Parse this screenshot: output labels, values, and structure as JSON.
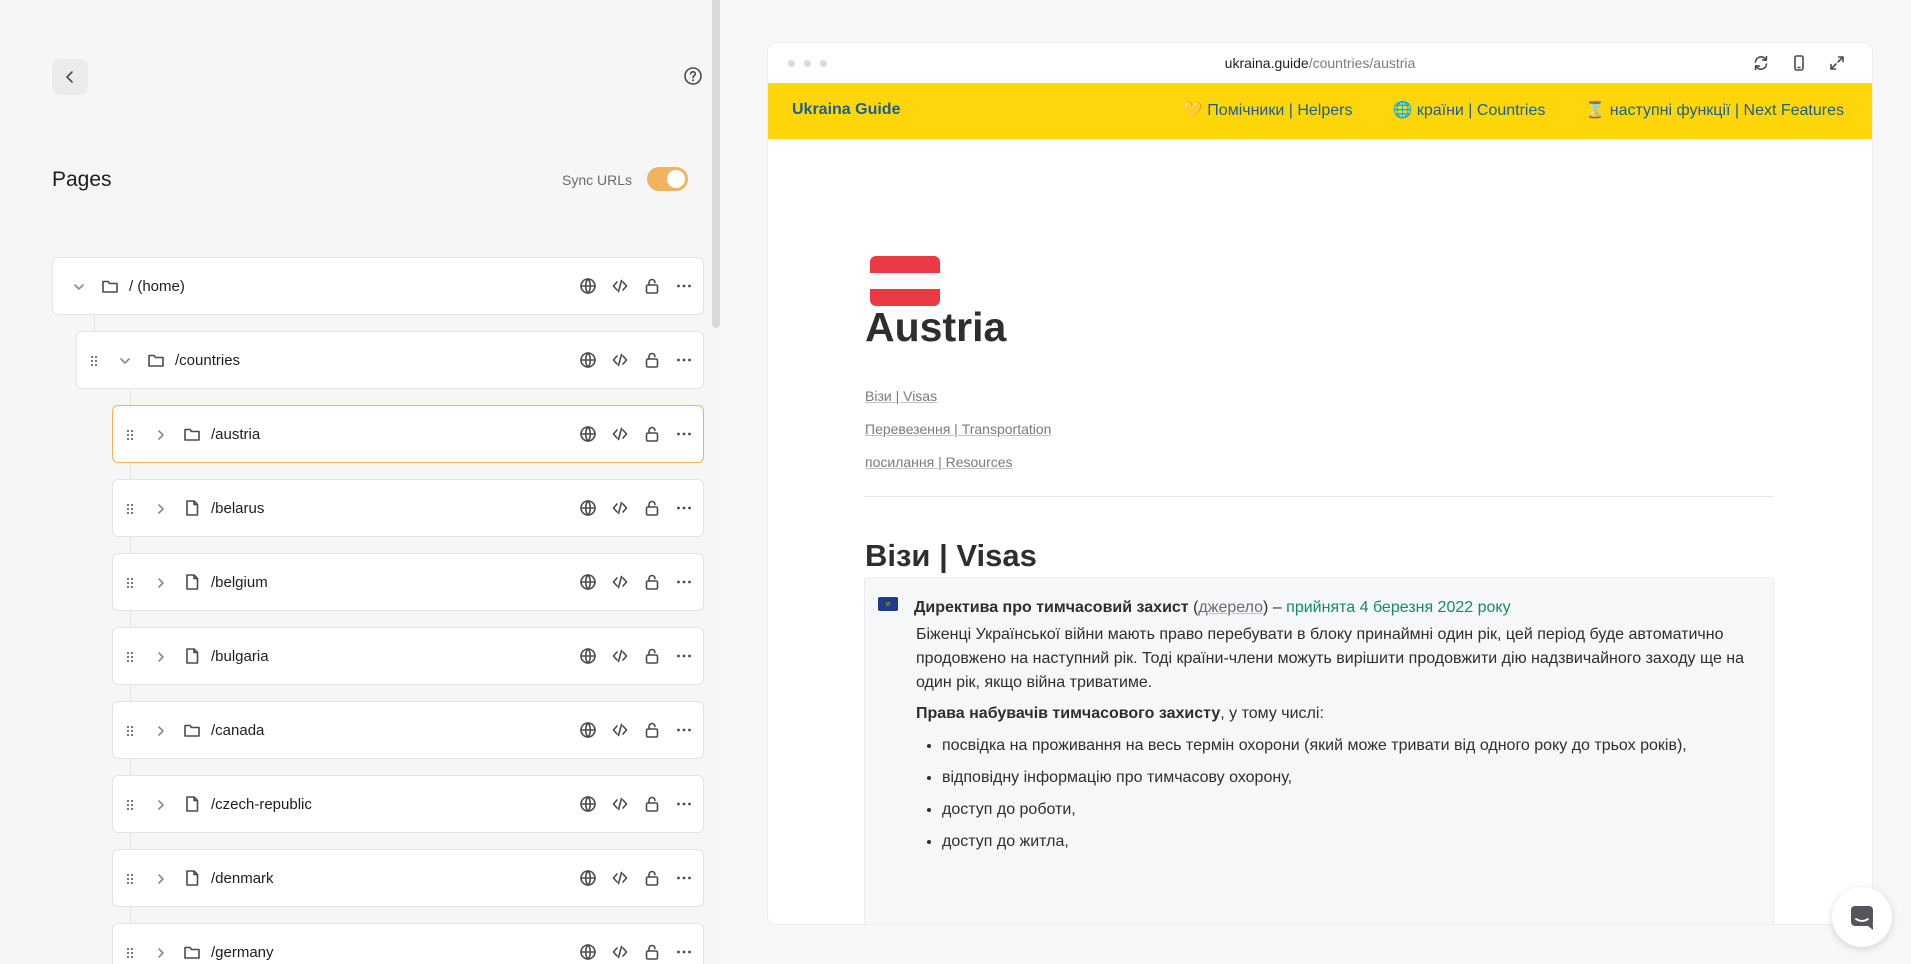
{
  "sidebar": {
    "back_icon": "chevron-left-icon",
    "help_icon": "question-circle-icon",
    "title": "Pages",
    "sync_label": "Sync URLs",
    "sync_enabled": true,
    "accent_color": "#f0b45d",
    "rows": [
      {
        "name": "/ (home)",
        "kind": "folder",
        "expanded": true,
        "selected": false
      },
      {
        "name": "/countries",
        "kind": "folder",
        "expanded": true,
        "selected": false
      },
      {
        "name": "/austria",
        "kind": "folder",
        "expanded": false,
        "selected": true
      },
      {
        "name": "/belarus",
        "kind": "page",
        "expanded": false,
        "selected": false
      },
      {
        "name": "/belgium",
        "kind": "page",
        "expanded": false,
        "selected": false
      },
      {
        "name": "/bulgaria",
        "kind": "page",
        "expanded": false,
        "selected": false
      },
      {
        "name": "/canada",
        "kind": "folder",
        "expanded": false,
        "selected": false
      },
      {
        "name": "/czech-republic",
        "kind": "page",
        "expanded": false,
        "selected": false
      },
      {
        "name": "/denmark",
        "kind": "page",
        "expanded": false,
        "selected": false
      },
      {
        "name": "/germany",
        "kind": "folder",
        "expanded": false,
        "selected": false
      }
    ],
    "row_actions": [
      "globe-icon",
      "code-icon",
      "lock-icon",
      "more-icon"
    ]
  },
  "browser": {
    "url_host": "ukraina.guide",
    "url_path": "/countries/austria",
    "actions": [
      "refresh-icon",
      "mobile-icon",
      "expand-icon"
    ]
  },
  "site": {
    "brand": "Ukraina Guide",
    "nav_color": "#ffd60a",
    "links": [
      "💛 Помічники | Helpers",
      "🌐 країни | Countries",
      "⌛ наступні функції | Next Features"
    ]
  },
  "page": {
    "flag": "Austria flag",
    "title": "Austria",
    "toc": [
      "Візи | Visas",
      "Перевезення | Transportation",
      "посилання | Resources"
    ],
    "section_title": "Візи | Visas",
    "callout": {
      "heading": "Директива про тимчасовий захист",
      "source_open": " (",
      "source": "джерело",
      "source_close": ") – ",
      "adopted": "прийнята 4 березня 2022 року",
      "paragraph": "Біженці Української війни мають право перебувати в блоку принаймні один рік, цей період буде автоматично продовжено на наступний рік. Тоді країни-члени можуть вирішити продовжити дію надзвичайного заходу ще на один рік, якщо війна триватиме.",
      "rights_bold": "Права набувачів тимчасового захисту",
      "rights_rest": ", у тому числі:",
      "items": [
        "посвідка на проживання на весь термін охорони (який може тривати від одного року до трьох років),",
        "відповідну інформацію про тимчасову охорону,",
        "доступ до роботи,",
        "доступ до житла,"
      ]
    }
  },
  "chat": {
    "icon": "chat-icon"
  }
}
